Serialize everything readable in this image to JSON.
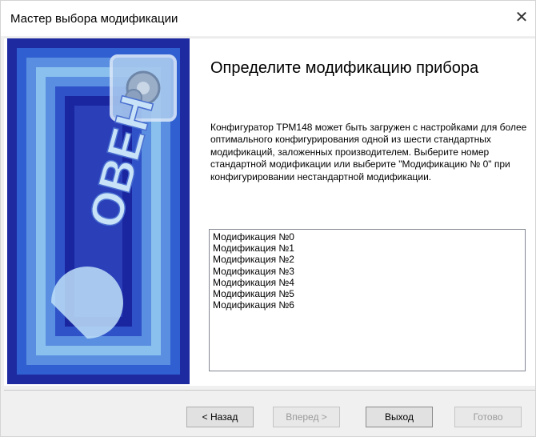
{
  "window": {
    "title": "Мастер выбора модификации",
    "close_glyph": "✕"
  },
  "banner": {
    "logo_text": "ОВЕН",
    "gear_icon": "gear-icon"
  },
  "main": {
    "heading": "Определите модификацию прибора",
    "description": "Конфигуратор ТРМ148 может быть загружен с настройками для более оптимального конфигурирования одной из шести стандартных модификаций, заложенных производителем. Выберите номер стандартной модификации или выберите \"Модификацию № 0\" при конфигурировании нестандартной модификации.",
    "options": [
      "Модификация №0",
      "Модификация №1",
      "Модификация №2",
      "Модификация №3",
      "Модификация №4",
      "Модификация №5",
      "Модификация №6"
    ]
  },
  "footer": {
    "back_label": "< Назад",
    "next_label": "Вперед >",
    "exit_label": "Выход",
    "finish_label": "Готово"
  },
  "colors": {
    "banner_dark": "#1f2fa0",
    "banner_light": "#7fb6e8",
    "accent": "#0078d7"
  }
}
